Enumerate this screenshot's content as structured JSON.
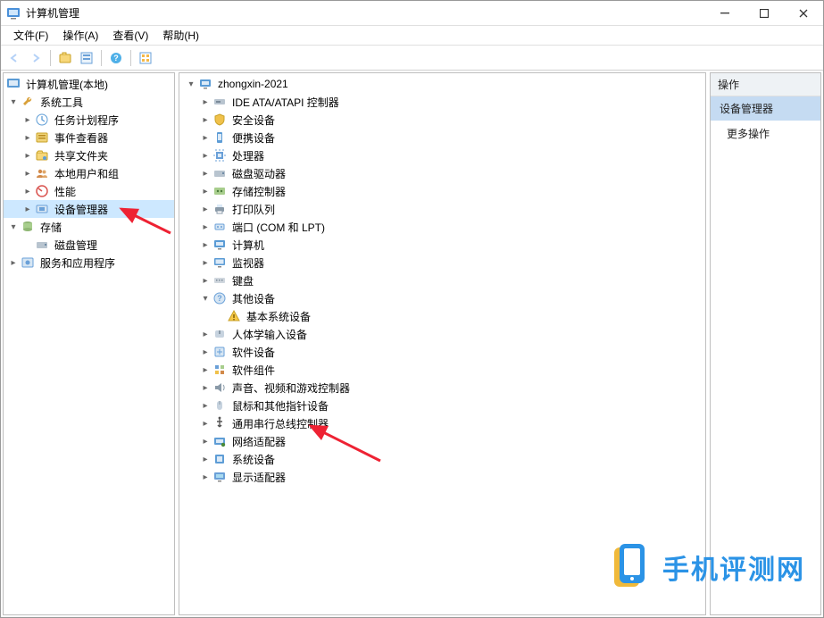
{
  "window": {
    "title": "计算机管理"
  },
  "menus": [
    "文件(F)",
    "操作(A)",
    "查看(V)",
    "帮助(H)"
  ],
  "toolbar_icons": [
    "back",
    "forward",
    "up",
    "props",
    "grid",
    "help",
    "refresh"
  ],
  "right_panel": {
    "header": "操作",
    "selected": "设备管理器",
    "more": "更多操作"
  },
  "left_tree": {
    "root": {
      "label": "计算机管理(本地)",
      "icon": "computer-mgmt"
    },
    "system_tools": {
      "label": "系统工具",
      "icon": "wrench",
      "children": [
        {
          "label": "任务计划程序",
          "icon": "task-scheduler"
        },
        {
          "label": "事件查看器",
          "icon": "event-viewer"
        },
        {
          "label": "共享文件夹",
          "icon": "shared-folders"
        },
        {
          "label": "本地用户和组",
          "icon": "users-groups"
        },
        {
          "label": "性能",
          "icon": "performance"
        },
        {
          "label": "设备管理器",
          "icon": "device-manager",
          "selected": true
        }
      ]
    },
    "storage": {
      "label": "存储",
      "icon": "storage",
      "children": [
        {
          "label": "磁盘管理",
          "icon": "disk-mgmt"
        }
      ]
    },
    "services": {
      "label": "服务和应用程序",
      "icon": "services"
    }
  },
  "mid_tree": {
    "root": {
      "label": "zhongxin-2021",
      "icon": "computer"
    },
    "children": [
      {
        "label": "IDE ATA/ATAPI 控制器",
        "icon": "ide"
      },
      {
        "label": "安全设备",
        "icon": "security"
      },
      {
        "label": "便携设备",
        "icon": "portable"
      },
      {
        "label": "处理器",
        "icon": "cpu"
      },
      {
        "label": "磁盘驱动器",
        "icon": "disk"
      },
      {
        "label": "存储控制器",
        "icon": "storage-ctrl"
      },
      {
        "label": "打印队列",
        "icon": "printer"
      },
      {
        "label": "端口 (COM 和 LPT)",
        "icon": "port"
      },
      {
        "label": "计算机",
        "icon": "computer"
      },
      {
        "label": "监视器",
        "icon": "monitor"
      },
      {
        "label": "键盘",
        "icon": "keyboard"
      },
      {
        "label": "其他设备",
        "icon": "other",
        "expanded": true,
        "child": {
          "label": "基本系统设备",
          "icon": "warning"
        }
      },
      {
        "label": "人体学输入设备",
        "icon": "hid"
      },
      {
        "label": "软件设备",
        "icon": "software"
      },
      {
        "label": "软件组件",
        "icon": "component"
      },
      {
        "label": "声音、视频和游戏控制器",
        "icon": "sound"
      },
      {
        "label": "鼠标和其他指针设备",
        "icon": "mouse"
      },
      {
        "label": "通用串行总线控制器",
        "icon": "usb"
      },
      {
        "label": "网络适配器",
        "icon": "network"
      },
      {
        "label": "系统设备",
        "icon": "system"
      },
      {
        "label": "显示适配器",
        "icon": "display"
      }
    ]
  },
  "watermark": {
    "text": "手机评测网"
  }
}
